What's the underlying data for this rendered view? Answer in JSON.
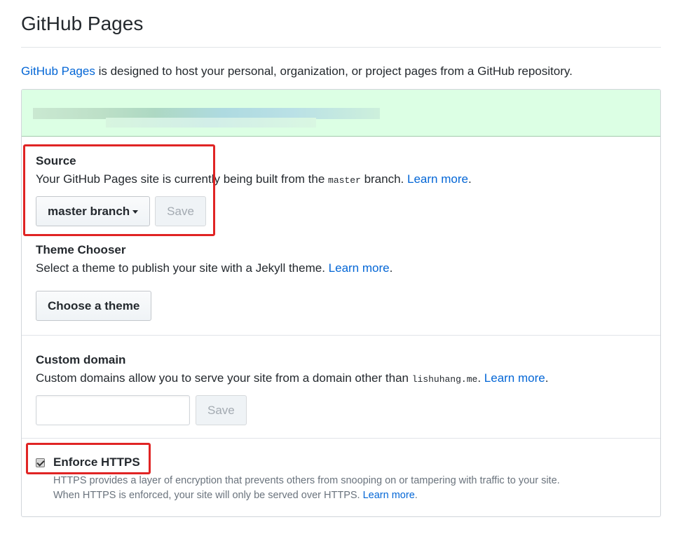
{
  "page": {
    "title": "GitHub Pages",
    "intro_link": "GitHub Pages",
    "intro_text": " is designed to host your personal, organization, or project pages from a GitHub repository."
  },
  "colors": {
    "link": "#0366d6",
    "flash_bg": "#dcffe4",
    "annotation": "#e02424"
  },
  "source": {
    "label": "Source",
    "desc_prefix": "Your GitHub Pages site is currently being built from the ",
    "branch_code": "master",
    "desc_suffix": " branch. ",
    "learn_more": "Learn more",
    "period": ".",
    "branch_select": "master branch",
    "save_label": "Save"
  },
  "theme": {
    "label": "Theme Chooser",
    "desc": "Select a theme to publish your site with a Jekyll theme. ",
    "learn_more": "Learn more",
    "period": ".",
    "button": "Choose a theme"
  },
  "domain": {
    "label": "Custom domain",
    "desc_prefix": "Custom domains allow you to serve your site from a domain other than ",
    "domain_code": "lishuhang.me",
    "desc_suffix": ". ",
    "learn_more": "Learn more",
    "period": ".",
    "input_value": "",
    "save_label": "Save"
  },
  "https": {
    "label": "Enforce HTTPS",
    "checked": true,
    "desc_line1": "HTTPS provides a layer of encryption that prevents others from snooping on or tampering with traffic to your site.",
    "desc_line2": "When HTTPS is enforced, your site will only be served over HTTPS. ",
    "learn_more": "Learn more",
    "period": "."
  },
  "icons": {
    "caret": "caret-down-icon",
    "checkbox": "checkmark-icon"
  }
}
